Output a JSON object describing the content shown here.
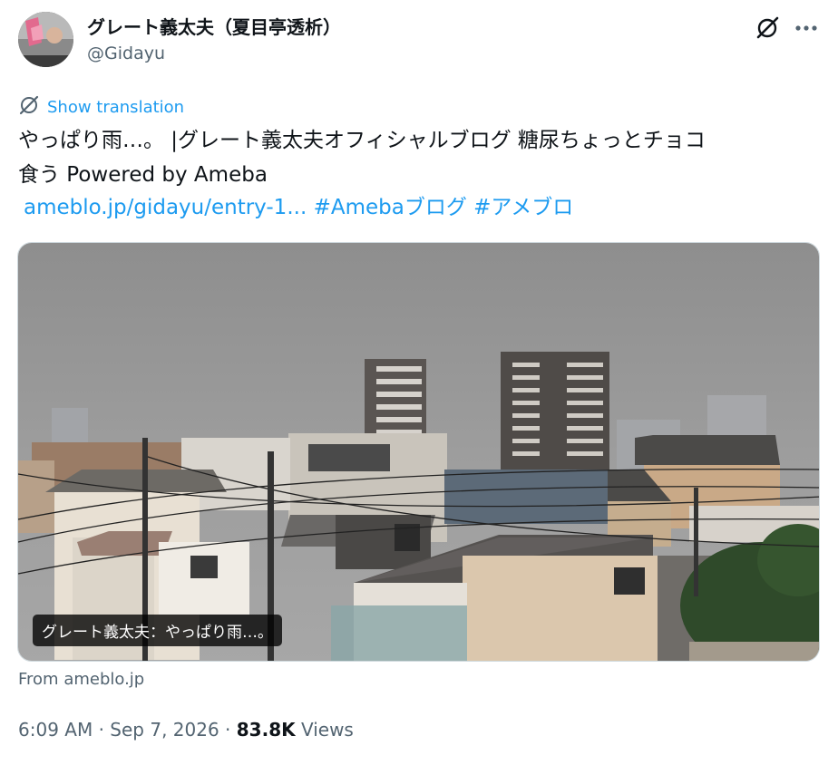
{
  "author": {
    "display_name": "グレート義太夫（夏目亭透析）",
    "handle": "@Gidayu"
  },
  "icons": {
    "x_logo": "x-grok-icon",
    "more": "more-horizontal-icon",
    "translate": "translate-icon"
  },
  "tweet": {
    "translate_label": "Show translation",
    "text_line_1": "やっぱり雨…。 |グレート義太夫オフィシャルブログ 糖尿ちょっとチョコ",
    "text_line_2": "食う Powered by Ameba",
    "link_url": "ameblo.jp/gidayu/entry-1...",
    "hashtag_1": "#Amebaブログ",
    "hashtag_2": "#アメブロ"
  },
  "card": {
    "caption": "グレート義太夫：やっぱり雨…。",
    "from": "From ameblo.jp"
  },
  "meta": {
    "time": "6:09 AM",
    "separator": "·",
    "date": "Sep 7, 2026",
    "views_count": "83.8K",
    "views_label": "Views"
  },
  "colors": {
    "accent": "#1d9bf0",
    "text": "#0f1419",
    "secondary": "#536471"
  }
}
